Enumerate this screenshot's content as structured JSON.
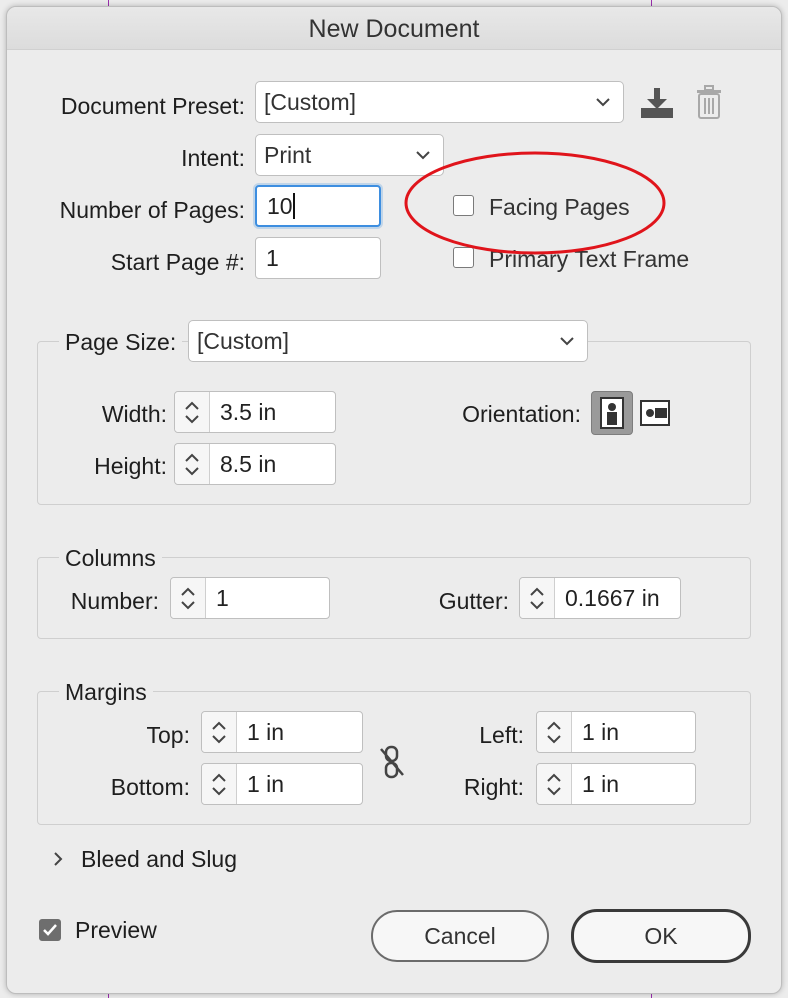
{
  "window": {
    "title": "New Document"
  },
  "preset": {
    "label": "Document Preset:",
    "value": "[Custom]"
  },
  "intent": {
    "label": "Intent:",
    "value": "Print"
  },
  "pages": {
    "number_label": "Number of Pages:",
    "number_value": "10",
    "start_label": "Start Page #:",
    "start_value": "1"
  },
  "options": {
    "facing_pages": {
      "label": "Facing Pages",
      "checked": false
    },
    "primary_text_frame": {
      "label": "Primary Text Frame",
      "checked": false
    }
  },
  "page_size": {
    "label": "Page Size:",
    "value": "[Custom]",
    "width_label": "Width:",
    "width_value": "3.5 in",
    "height_label": "Height:",
    "height_value": "8.5 in",
    "orientation_label": "Orientation:",
    "orientation_selected": "portrait"
  },
  "columns": {
    "title": "Columns",
    "number_label": "Number:",
    "number_value": "1",
    "gutter_label": "Gutter:",
    "gutter_value": "0.1667 in"
  },
  "margins": {
    "title": "Margins",
    "top_label": "Top:",
    "top_value": "1 in",
    "bottom_label": "Bottom:",
    "bottom_value": "1 in",
    "left_label": "Left:",
    "left_value": "1 in",
    "right_label": "Right:",
    "right_value": "1 in"
  },
  "bleed": {
    "label": "Bleed and Slug"
  },
  "preview": {
    "label": "Preview",
    "checked": true
  },
  "buttons": {
    "cancel": "Cancel",
    "ok": "OK"
  },
  "colors": {
    "annotation_circle": "#e0141b",
    "focus_ring": "#3d8ee0",
    "guide": "#9b2fae"
  }
}
